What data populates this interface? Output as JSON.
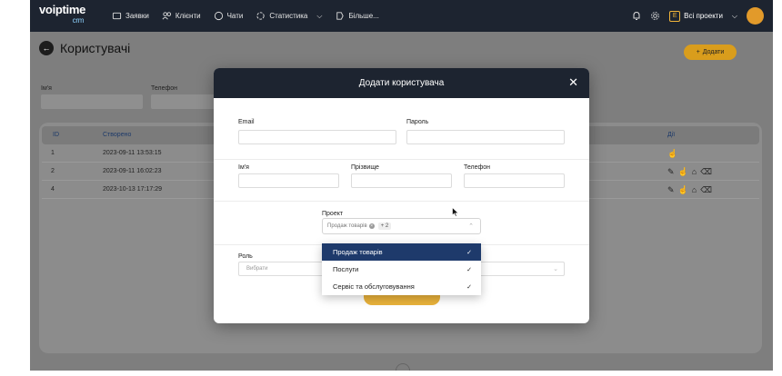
{
  "brand": {
    "name": "voiptime",
    "sub": "crm"
  },
  "nav": [
    {
      "icon": "tickets-icon",
      "label": "Заявки"
    },
    {
      "icon": "clients-icon",
      "label": "Клієнти"
    },
    {
      "icon": "chat-icon",
      "label": "Чати"
    },
    {
      "icon": "stats-icon",
      "label": "Статистика",
      "chevron": "⌵"
    },
    {
      "icon": "more-icon",
      "label": "Більше..."
    }
  ],
  "topright": {
    "project_badge": "E",
    "projects_label": "Всі проекти"
  },
  "page": {
    "title": "Користувачі",
    "add_button": "Додати"
  },
  "filters": {
    "name_label": "Ім'я",
    "phone_label": "Телефон"
  },
  "table": {
    "headers": {
      "id": "ID",
      "created": "Створено",
      "actions": "Дії"
    },
    "rows": [
      {
        "id": "1",
        "created": "2023-09-11 13:53:15"
      },
      {
        "id": "2",
        "created": "2023-09-11 16:02:23"
      },
      {
        "id": "4",
        "created": "2023-10-13 17:17:29"
      }
    ]
  },
  "modal": {
    "title": "Додати користувача",
    "close": "✕",
    "email_label": "Email",
    "password_label": "Пароль",
    "first_name_label": "Ім'я",
    "last_name_label": "Прізвище",
    "phone_label": "Телефон",
    "project_label": "Проект",
    "project_chip": "Продаж товарів",
    "project_more": "+ 2",
    "role_label": "Роль",
    "role_placeholder": "Вибрати",
    "dropdown": [
      {
        "label": "Продаж товарів",
        "selected": true
      },
      {
        "label": "Послуги",
        "selected": true
      },
      {
        "label": "Сервіс та обслуговування",
        "selected": true
      }
    ]
  },
  "colors": {
    "navbar": "#1d2430",
    "accent": "#e9b23b",
    "selected": "#1e3a6b"
  }
}
